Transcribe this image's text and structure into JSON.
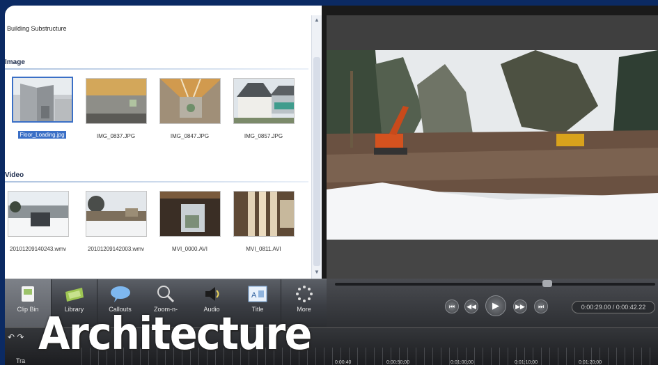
{
  "bin": {
    "project_title": "Building Substructure",
    "image_header": "Image",
    "video_header": "Video",
    "images": [
      {
        "label": "Floor_Loading.jpg",
        "selected": true
      },
      {
        "label": "IMG_0837.JPG",
        "selected": false
      },
      {
        "label": "IMG_0847.JPG",
        "selected": false
      },
      {
        "label": "IMG_0857.JPG",
        "selected": false
      }
    ],
    "videos": [
      {
        "label": "20101209140243.wmv"
      },
      {
        "label": "20101209142003.wmv"
      },
      {
        "label": "MVI_0000.AVI"
      },
      {
        "label": "MVI_0811.AVI"
      }
    ]
  },
  "toolbar": {
    "tools": [
      {
        "label": "Clip Bin",
        "icon": "clip-bin-icon",
        "active": true
      },
      {
        "label": "Library",
        "icon": "library-icon"
      },
      {
        "label": "Callouts",
        "icon": "callouts-icon"
      },
      {
        "label": "Zoom-n-",
        "icon": "zoom-icon"
      },
      {
        "label": "Audio",
        "icon": "audio-icon"
      },
      {
        "label": "Title",
        "icon": "title-icon"
      },
      {
        "label": "More",
        "icon": "more-icon"
      }
    ]
  },
  "player": {
    "timecode": "0:00:29.00 / 0:00:42.22"
  },
  "timeline": {
    "tracks_label": "Tra",
    "ticks": [
      "0:00:40",
      "0:00:50;00",
      "0:01:00;00",
      "0:01:10;00",
      "0:01:20;00"
    ]
  },
  "caption": "Architecture",
  "colors": {
    "frame": "#0b2a63",
    "selection": "#3a6fc6"
  }
}
